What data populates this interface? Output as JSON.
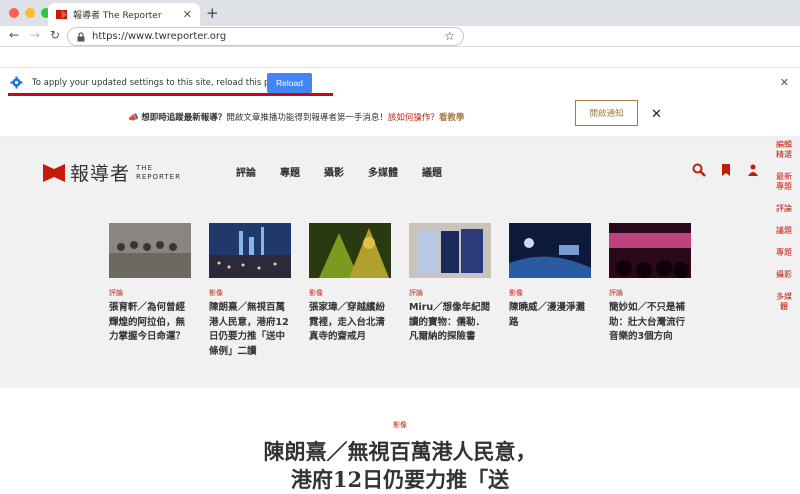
{
  "browser": {
    "tab_title": "報導者 The Reporter",
    "url": "https://www.twreporter.org",
    "info_message": "To apply your updated settings to this site, reload this page",
    "reload_label": "Reload"
  },
  "notify_bar": {
    "icon": "horn-icon",
    "question": "想即時追蹤最新報導？",
    "body": "開啟文章推播功能得到報導者第一手消息！",
    "help_link": "該如何操作？",
    "tutorial_link": "看教學",
    "button_label": "開啟通知"
  },
  "site": {
    "logo_zh": "報導者",
    "logo_en_line1": "THE",
    "logo_en_line2": "REPORTER",
    "nav": [
      "評論",
      "專題",
      "攝影",
      "多媒體",
      "議題"
    ],
    "side_nav": [
      "編輯精選",
      "最新專題",
      "評論",
      "議題",
      "專題",
      "攝影",
      "多媒體"
    ]
  },
  "cards": [
    {
      "category": "評論",
      "title": "張育軒／為何曾經輝煌的阿拉伯，無力掌握今日命運？",
      "img_color": "#8a8580"
    },
    {
      "category": "影像",
      "title": "陳朗熹／無視百萬港人民意，港府12日仍要力推「送中條例」二讀",
      "img_color": "#2c4a7a"
    },
    {
      "category": "影像",
      "title": "張家瑋／穿越繽紛霓裡，走入台北清真寺的齋戒月",
      "img_color": "#5a6a20"
    },
    {
      "category": "評論",
      "title": "Miru／想像年紀閱讀的寶物：儒勒．凡爾納的探險書",
      "img_color": "#3a4a6a"
    },
    {
      "category": "影像",
      "title": "陳曉威／漫漫淨灘路",
      "img_color": "#1a2a4a"
    },
    {
      "category": "評論",
      "title": "簡妙如／不只是補助：壯大台灣流行音樂的3個方向",
      "img_color": "#6a2a4a"
    }
  ],
  "headline": {
    "category": "影像",
    "line1": "陳朗熹／無視百萬港人民意，",
    "line2": "港府12日仍要力推「送"
  },
  "colors": {
    "brand_red": "#c71b0a",
    "accent_gold": "#a67a44",
    "reload_blue": "#4285f4"
  }
}
